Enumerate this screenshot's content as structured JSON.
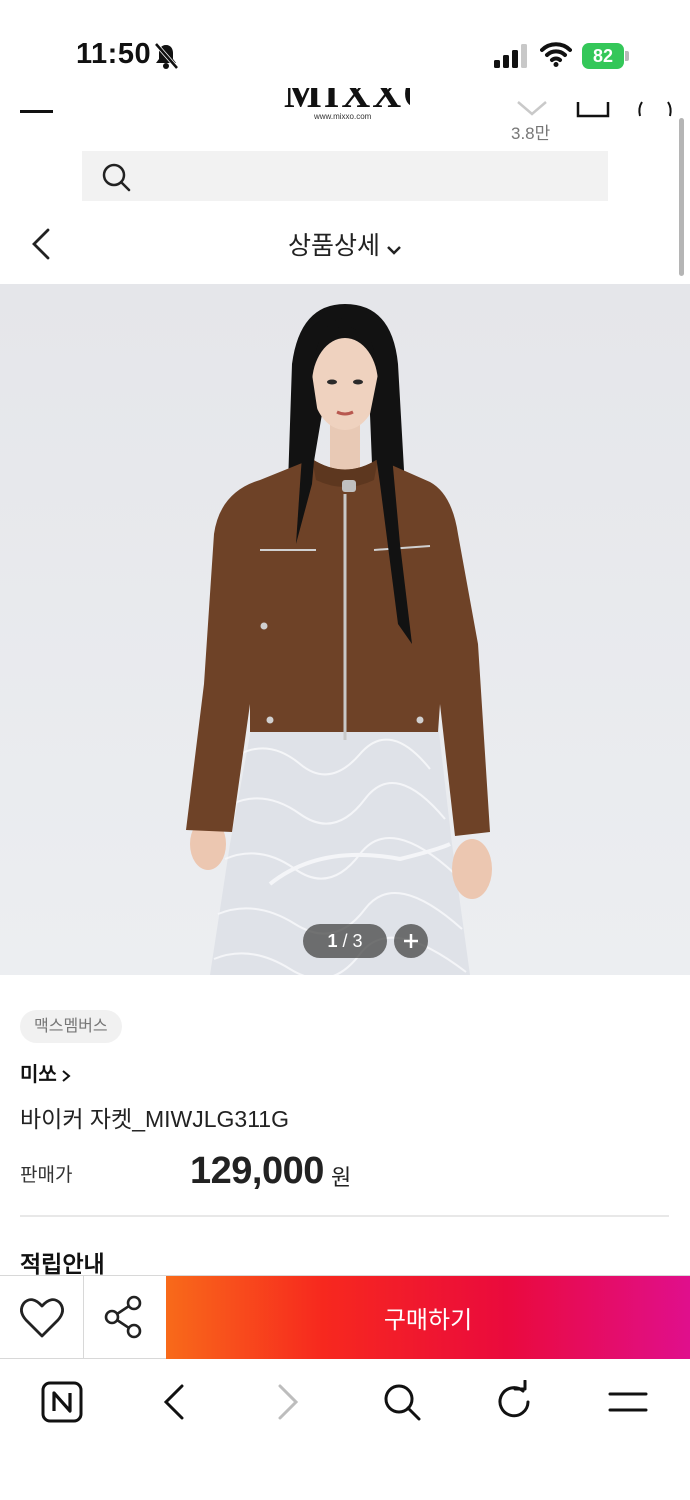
{
  "status_bar": {
    "time": "11:50",
    "battery": "82",
    "icons": [
      "bell-slash-icon",
      "signal-icon",
      "wifi-icon",
      "battery-icon"
    ],
    "battery_color": "#34c759"
  },
  "header": {
    "logo_url": "www.mixxo.com",
    "like_count": "3.8만",
    "search": {
      "placeholder": "",
      "value": ""
    },
    "page_title": "상품상세",
    "scroll_position": 0.1
  },
  "gallery": {
    "page_current": "1",
    "page_separator": "/",
    "page_total": "3"
  },
  "product": {
    "badge": "맥스멤버스",
    "brand": "미쏘",
    "name": "바이커 자켓_MIWJLG311G",
    "price_label": "판매가",
    "price": "129,000",
    "price_unit": "원",
    "section_title": "적립안내"
  },
  "purchase_bar": {
    "buy_label": "구매하기",
    "gradient": [
      "#f86a1a",
      "#f7281e",
      "#ea0a3d",
      "#e00f8c"
    ]
  },
  "browser_toolbar": {
    "icons": [
      "naver-icon",
      "back-arrow-icon",
      "forward-arrow-icon",
      "search-icon",
      "refresh-icon",
      "menu-icon"
    ]
  }
}
